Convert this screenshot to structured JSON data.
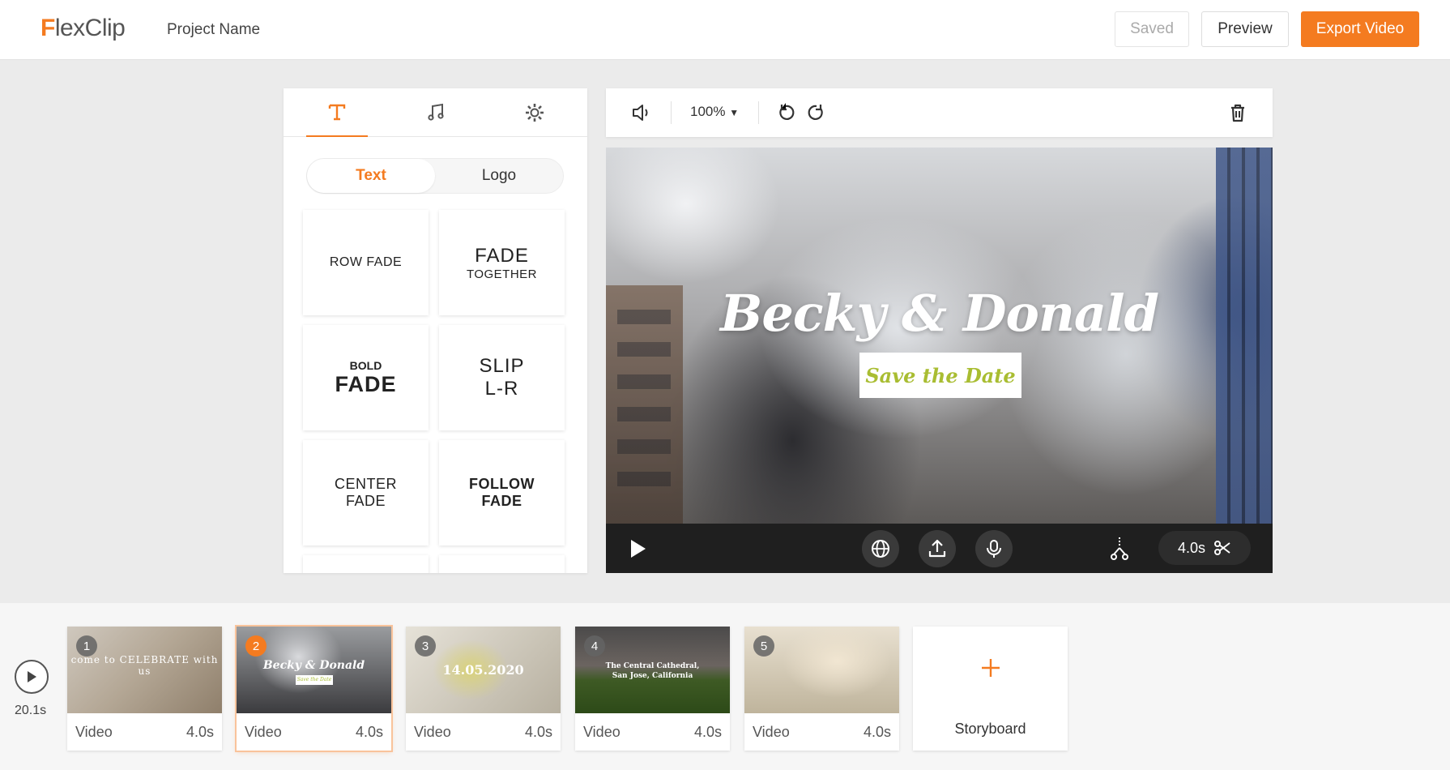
{
  "header": {
    "logo_first": "F",
    "logo_rest": "lexClip",
    "project_name": "Project Name",
    "saved_label": "Saved",
    "preview_label": "Preview",
    "export_label": "Export Video",
    "accent_color": "#f47b20"
  },
  "panel": {
    "tabs": [
      {
        "icon": "text-icon",
        "active": true
      },
      {
        "icon": "music-note-icon",
        "active": false
      },
      {
        "icon": "gear-icon",
        "active": false
      }
    ],
    "segment": {
      "text_label": "Text",
      "logo_label": "Logo"
    },
    "effects": [
      {
        "line1": "ROW FADE",
        "line2": ""
      },
      {
        "line1": "FADE",
        "line2": "TOGETHER"
      },
      {
        "line1": "BOLD",
        "line2": "FADE"
      },
      {
        "line1": "SLIP",
        "line2": "L-R"
      },
      {
        "line1": "CENTER",
        "line2": "FADE"
      },
      {
        "line1": "FOLLOW",
        "line2": "FADE"
      }
    ]
  },
  "toolbar": {
    "zoom": "100%",
    "icons": [
      "volume-icon",
      "undo-icon",
      "redo-icon",
      "trash-icon"
    ]
  },
  "preview": {
    "title": "Becky & Donald",
    "subtitle": "Save the Date",
    "subtitle_color": "#a9bd32",
    "duration": "4.0s",
    "control_icons": [
      "play-icon",
      "globe-icon",
      "upload-icon",
      "microphone-icon",
      "split-icon",
      "scissors-icon"
    ]
  },
  "timeline": {
    "total_duration": "20.1s",
    "clips": [
      {
        "number": "1",
        "type": "Video",
        "duration": "4.0s",
        "thumb_text": "come to CELEBRATE with us",
        "selected": false
      },
      {
        "number": "2",
        "type": "Video",
        "duration": "4.0s",
        "thumb_text": "Becky & Donald",
        "thumb_sub": "Save the Date",
        "selected": true
      },
      {
        "number": "3",
        "type": "Video",
        "duration": "4.0s",
        "thumb_text": "14.05.2020",
        "selected": false
      },
      {
        "number": "4",
        "type": "Video",
        "duration": "4.0s",
        "thumb_text": "The Central Cathedral,",
        "thumb_sub": "San Jose, California",
        "selected": false
      },
      {
        "number": "5",
        "type": "Video",
        "duration": "4.0s",
        "thumb_text": "",
        "selected": false
      }
    ],
    "add_label": "Storyboard"
  }
}
